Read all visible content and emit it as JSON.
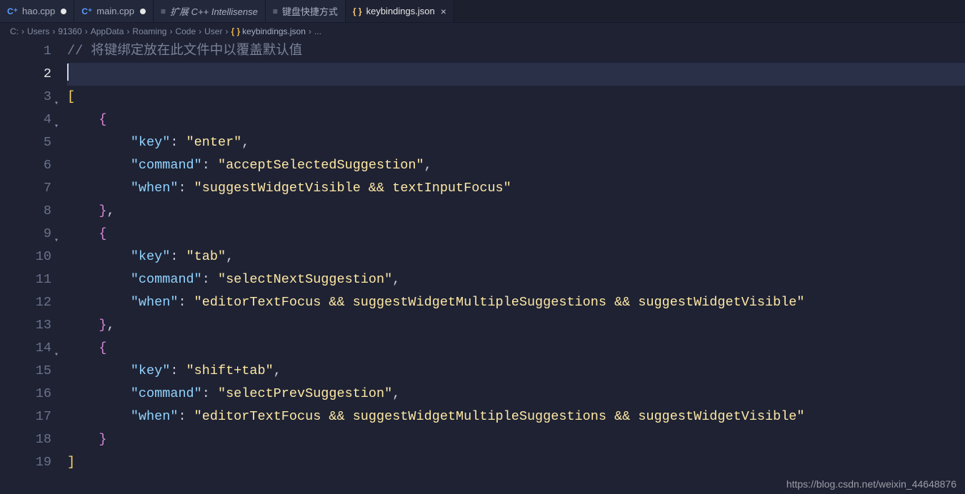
{
  "tabs": [
    {
      "icon": "cpp",
      "label": "hao.cpp",
      "dirty": true,
      "active": false,
      "italic": false
    },
    {
      "icon": "cpp",
      "label": "main.cpp",
      "dirty": true,
      "active": false,
      "italic": false
    },
    {
      "icon": "list",
      "label": "扩展 C++ Intellisense",
      "dirty": false,
      "active": false,
      "italic": true
    },
    {
      "icon": "kb",
      "label": "键盘快捷方式",
      "dirty": false,
      "active": false,
      "italic": false
    },
    {
      "icon": "json",
      "label": "keybindings.json",
      "dirty": false,
      "active": true,
      "italic": false,
      "close": true
    }
  ],
  "breadcrumbs": {
    "segments": [
      "C:",
      "Users",
      "91360",
      "AppData",
      "Roaming",
      "Code",
      "User"
    ],
    "file_icon": "json",
    "file": "keybindings.json",
    "tail": "..."
  },
  "editor": {
    "current_line_index": 1,
    "lines": [
      {
        "n": 1,
        "tokens": [
          {
            "t": "// 将键绑定放在此文件中以覆盖默认值",
            "c": "c-comment"
          }
        ]
      },
      {
        "n": 2,
        "tokens": [],
        "cursor": true
      },
      {
        "n": 3,
        "tokens": [
          {
            "t": "[",
            "c": "c-bracket-y"
          }
        ]
      },
      {
        "n": 4,
        "tokens": [
          {
            "t": "    ",
            "c": ""
          },
          {
            "t": "{",
            "c": "c-bracket-p"
          }
        ]
      },
      {
        "n": 5,
        "tokens": [
          {
            "t": "        ",
            "c": ""
          },
          {
            "t": "\"key\"",
            "c": "c-key"
          },
          {
            "t": ": ",
            "c": "c-colon"
          },
          {
            "t": "\"enter\"",
            "c": "c-str"
          },
          {
            "t": ",",
            "c": "c-punct"
          }
        ]
      },
      {
        "n": 6,
        "tokens": [
          {
            "t": "        ",
            "c": ""
          },
          {
            "t": "\"command\"",
            "c": "c-key"
          },
          {
            "t": ": ",
            "c": "c-colon"
          },
          {
            "t": "\"acceptSelectedSuggestion\"",
            "c": "c-str"
          },
          {
            "t": ",",
            "c": "c-punct"
          }
        ]
      },
      {
        "n": 7,
        "tokens": [
          {
            "t": "        ",
            "c": ""
          },
          {
            "t": "\"when\"",
            "c": "c-key"
          },
          {
            "t": ": ",
            "c": "c-colon"
          },
          {
            "t": "\"suggestWidgetVisible && textInputFocus\"",
            "c": "c-str"
          }
        ]
      },
      {
        "n": 8,
        "tokens": [
          {
            "t": "    ",
            "c": ""
          },
          {
            "t": "}",
            "c": "c-bracket-p"
          },
          {
            "t": ",",
            "c": "c-punct"
          }
        ]
      },
      {
        "n": 9,
        "tokens": [
          {
            "t": "    ",
            "c": ""
          },
          {
            "t": "{",
            "c": "c-bracket-p"
          }
        ]
      },
      {
        "n": 10,
        "tokens": [
          {
            "t": "        ",
            "c": ""
          },
          {
            "t": "\"key\"",
            "c": "c-key"
          },
          {
            "t": ": ",
            "c": "c-colon"
          },
          {
            "t": "\"tab\"",
            "c": "c-str"
          },
          {
            "t": ",",
            "c": "c-punct"
          }
        ]
      },
      {
        "n": 11,
        "tokens": [
          {
            "t": "        ",
            "c": ""
          },
          {
            "t": "\"command\"",
            "c": "c-key"
          },
          {
            "t": ": ",
            "c": "c-colon"
          },
          {
            "t": "\"selectNextSuggestion\"",
            "c": "c-str"
          },
          {
            "t": ",",
            "c": "c-punct"
          }
        ]
      },
      {
        "n": 12,
        "tokens": [
          {
            "t": "        ",
            "c": ""
          },
          {
            "t": "\"when\"",
            "c": "c-key"
          },
          {
            "t": ": ",
            "c": "c-colon"
          },
          {
            "t": "\"editorTextFocus && suggestWidgetMultipleSuggestions && suggestWidgetVisible\"",
            "c": "c-str"
          }
        ]
      },
      {
        "n": 13,
        "tokens": [
          {
            "t": "    ",
            "c": ""
          },
          {
            "t": "}",
            "c": "c-bracket-p"
          },
          {
            "t": ",",
            "c": "c-punct"
          }
        ]
      },
      {
        "n": 14,
        "tokens": [
          {
            "t": "    ",
            "c": ""
          },
          {
            "t": "{",
            "c": "c-bracket-p"
          }
        ]
      },
      {
        "n": 15,
        "tokens": [
          {
            "t": "        ",
            "c": ""
          },
          {
            "t": "\"key\"",
            "c": "c-key"
          },
          {
            "t": ": ",
            "c": "c-colon"
          },
          {
            "t": "\"shift+tab\"",
            "c": "c-str"
          },
          {
            "t": ",",
            "c": "c-punct"
          }
        ]
      },
      {
        "n": 16,
        "tokens": [
          {
            "t": "        ",
            "c": ""
          },
          {
            "t": "\"command\"",
            "c": "c-key"
          },
          {
            "t": ": ",
            "c": "c-colon"
          },
          {
            "t": "\"selectPrevSuggestion\"",
            "c": "c-str"
          },
          {
            "t": ",",
            "c": "c-punct"
          }
        ]
      },
      {
        "n": 17,
        "tokens": [
          {
            "t": "        ",
            "c": ""
          },
          {
            "t": "\"when\"",
            "c": "c-key"
          },
          {
            "t": ": ",
            "c": "c-colon"
          },
          {
            "t": "\"editorTextFocus && suggestWidgetMultipleSuggestions && suggestWidgetVisible\"",
            "c": "c-str"
          }
        ]
      },
      {
        "n": 18,
        "tokens": [
          {
            "t": "    ",
            "c": ""
          },
          {
            "t": "}",
            "c": "c-bracket-p"
          }
        ]
      },
      {
        "n": 19,
        "tokens": [
          {
            "t": "]",
            "c": "c-bracket-y"
          }
        ]
      }
    ],
    "fold_markers": [
      3,
      4,
      9,
      14
    ]
  },
  "watermark": "https://blog.csdn.net/weixin_44648876"
}
